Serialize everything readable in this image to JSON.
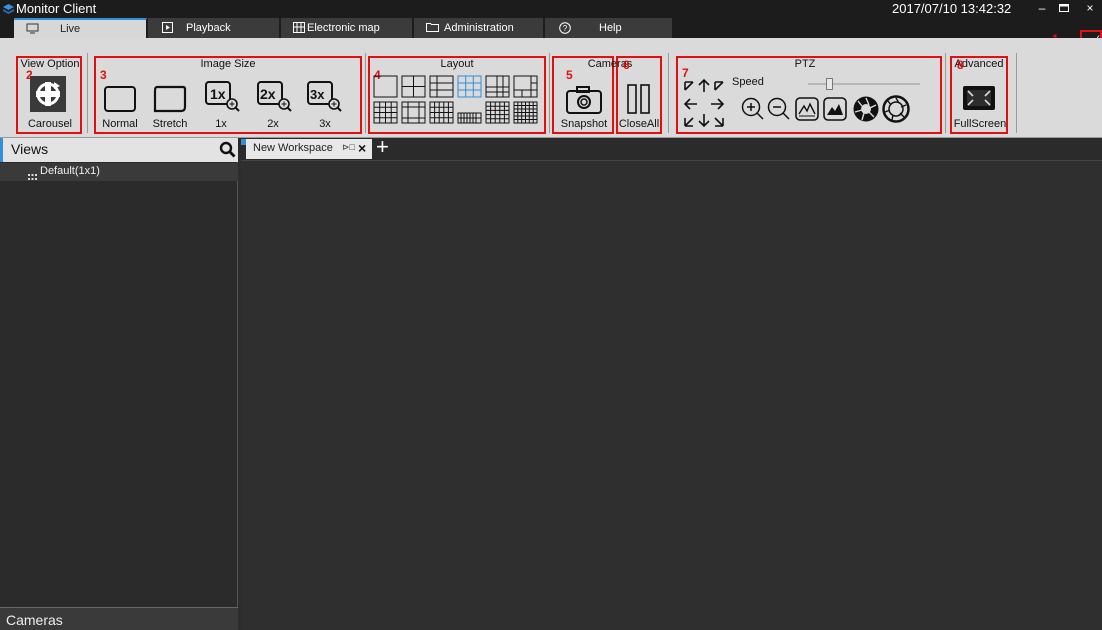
{
  "app": {
    "title": "Monitor Client",
    "datetime": "2017/07/10 13:42:32"
  },
  "window": {
    "minimize": "–",
    "maximize": "▭",
    "close": "×"
  },
  "tabs": [
    {
      "label": "Live"
    },
    {
      "label": "Playback"
    },
    {
      "label": "Electronic map"
    },
    {
      "label": "Administration"
    },
    {
      "label": "Help"
    }
  ],
  "toolbar": {
    "view_option": {
      "title": "View Option",
      "carousel": "Carousel"
    },
    "image_size": {
      "title": "Image Size",
      "normal": "Normal",
      "stretch": "Stretch",
      "x1": "1x",
      "x2": "2x",
      "x3": "3x",
      "icon1": "1x",
      "icon2": "2x",
      "icon3": "3x"
    },
    "layout": {
      "title": "Layout"
    },
    "cameras": {
      "title": "Cameras",
      "snapshot": "Snapshot",
      "close_all": "CloseAll"
    },
    "ptz": {
      "title": "PTZ",
      "speed": "Speed",
      "speed_level": 0.17
    },
    "advanced": {
      "title": "Advanced",
      "fullscreen": "FullScreen"
    }
  },
  "annotations": [
    "1",
    "2",
    "3",
    "4",
    "5",
    "6",
    "7",
    "8"
  ],
  "views": {
    "header": "Views",
    "items": [
      "Default(1x1)"
    ]
  },
  "cameras_panel": {
    "header": "Cameras"
  },
  "workspace": {
    "tab_label": "New Workspace",
    "tab_pin": "⊳□",
    "tab_close": "×",
    "add": "+"
  },
  "colors": {
    "accent": "#2f8fd8",
    "annotation": "#e01010",
    "titlebar": "#1c1c1c",
    "toolbar": "#dadada"
  }
}
